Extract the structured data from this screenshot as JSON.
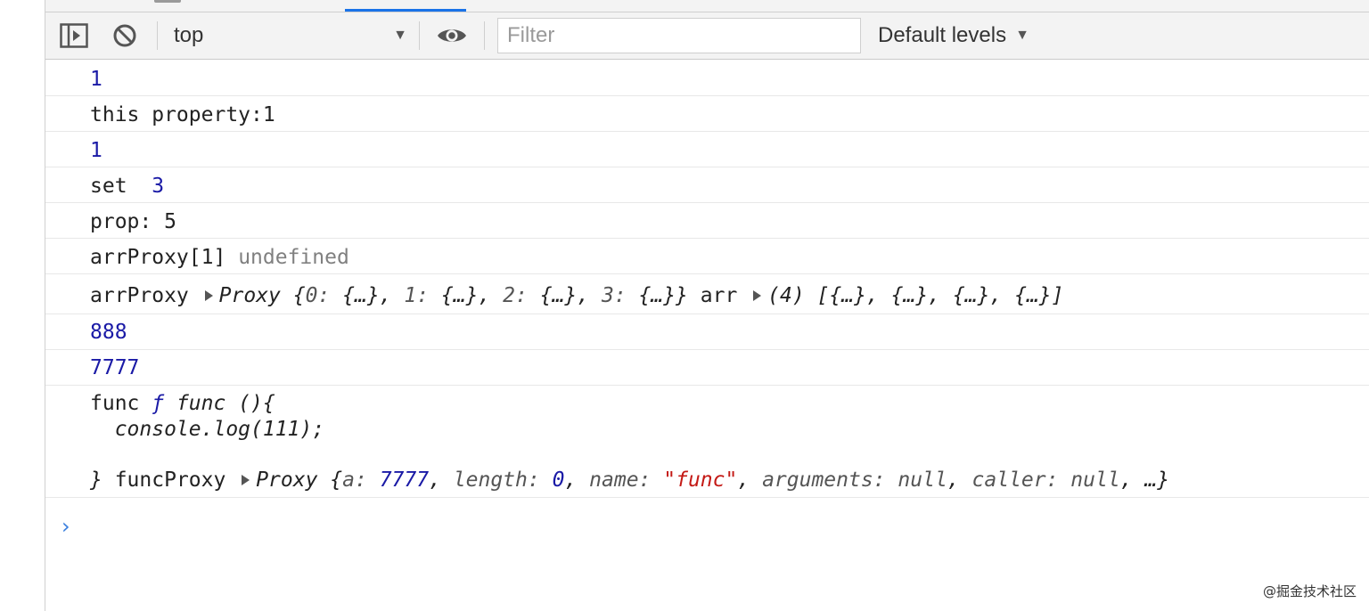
{
  "toolbar": {
    "context": "top",
    "filter_placeholder": "Filter",
    "levels": "Default levels"
  },
  "console": {
    "r1": "1",
    "r2": "this property:1",
    "r3": "1",
    "r4_label": "set",
    "r4_value": "3",
    "r5": "prop: 5",
    "r6_label": "arrProxy[1]",
    "r6_value": "undefined",
    "r7_label": "arrProxy",
    "r7_proxy": "Proxy {",
    "r7_k0": "0:",
    "r7_v0": " {…}, ",
    "r7_k1": "1:",
    "r7_v1": " {…}, ",
    "r7_k2": "2:",
    "r7_v2": " {…}, ",
    "r7_k3": "3:",
    "r7_v3": " {…}}",
    "r7_arr_label": " arr",
    "r7_arr_value": "(4) [{…}, {…}, {…}, {…}]",
    "r8": "888",
    "r9": "7777",
    "r10_label": "func ",
    "r10_f": "ƒ",
    "r10_sig": " func (){",
    "r10_body": "  console.log(111);",
    "r10_close": "}",
    "r10_proxy_label": " funcProxy",
    "r10_proxy_open": "Proxy {",
    "r10_k_a": "a:",
    "r10_v_a": "7777",
    "r10_k_len": "length:",
    "r10_v_len": "0",
    "r10_k_name": "name:",
    "r10_v_name": "\"func\"",
    "r10_k_args": "arguments:",
    "r10_v_args": "null",
    "r10_k_caller": "caller:",
    "r10_v_caller": "null",
    "r10_rest": "…}"
  },
  "watermark": "@掘金技术社区"
}
